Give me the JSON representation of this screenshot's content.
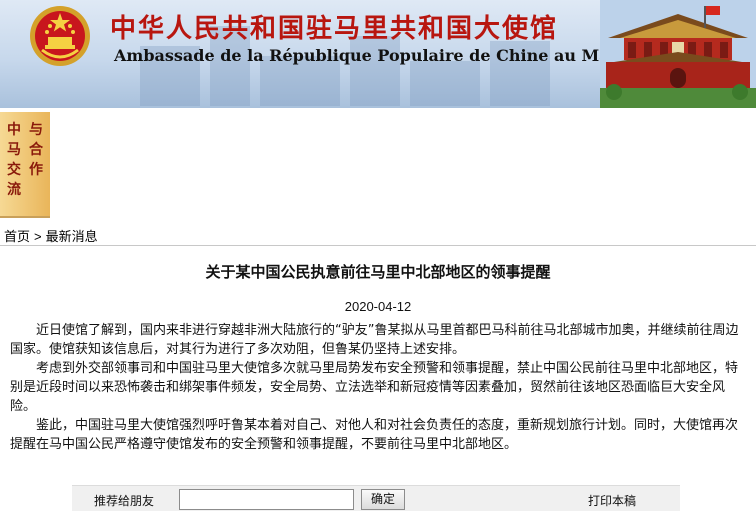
{
  "header": {
    "title_cn": "中华人民共和国驻马里共和国大使馆",
    "title_fr": "Ambassade de la République Populaire de Chine au Mali",
    "emblem_icon": "national-emblem-icon",
    "banner_image_icon": "tiananmen-gate-icon",
    "colors": {
      "title_red": "#b8160f",
      "banner_blue": "#c7d8ec"
    }
  },
  "sidetag": {
    "col1": "中马交流",
    "col2": "与合作"
  },
  "breadcrumb": {
    "home": "首页",
    "separator": ">",
    "section": "最新消息"
  },
  "article": {
    "title": "关于某中国公民执意前往马里中北部地区的领事提醒",
    "date": "2020-04-12",
    "paragraphs": [
      "近日使馆了解到，国内来非进行穿越非洲大陆旅行的“驴友”鲁某拟从马里首都巴马科前往马北部城市加奥，并继续前往周边国家。使馆获知该信息后，对其行为进行了多次劝阻，但鲁某仍坚持上述安排。",
      "考虑到外交部领事司和中国驻马里大使馆多次就马里局势发布安全预警和领事提醒，禁止中国公民前往马里中北部地区，特别是近段时间以来恐怖袭击和绑架事件频发，安全局势、立法选举和新冠疫情等因素叠加，贸然前往该地区恐面临巨大安全风险。",
      "鉴此，中国驻马里大使馆强烈呼吁鲁某本着对自己、对他人和对社会负责任的态度，重新规划旅行计划。同时，大使馆再次提醒在马中国公民严格遵守使馆发布的安全预警和领事提醒，不要前往马里中北部地区。"
    ]
  },
  "toolbar": {
    "recommend_label": "推荐给朋友",
    "recommend_value": "",
    "confirm_label": "确定",
    "print_label": "打印本稿"
  }
}
